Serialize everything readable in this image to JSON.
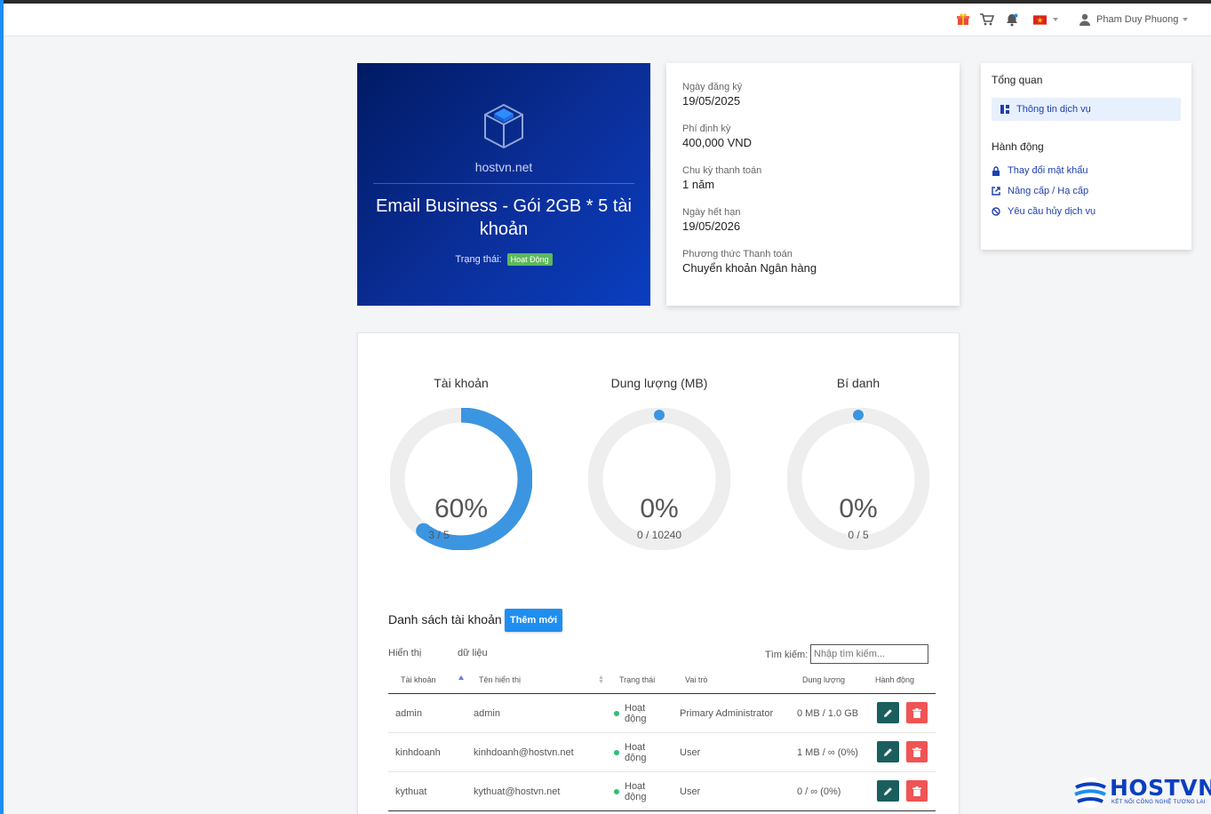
{
  "topbar": {
    "user_name": "Pham Duy Phuong",
    "icons": [
      "gift-icon",
      "cart-icon",
      "bell-icon",
      "vietnam-flag-icon",
      "user-icon"
    ]
  },
  "hero": {
    "brand": "hostvn.net",
    "title": "Email Business - Gói 2GB * 5 tài khoản",
    "status_label": "Trạng thái:",
    "status_value": "Hoạt Động"
  },
  "info": {
    "items": [
      {
        "label": "Ngày đăng ký",
        "value": "19/05/2025"
      },
      {
        "label": "Phí định kỳ",
        "value": "400,000 VND"
      },
      {
        "label": "Chu kỳ thanh toán",
        "value": "1 năm"
      },
      {
        "label": "Ngày hết hạn",
        "value": "19/05/2026"
      },
      {
        "label": "Phương thức Thanh toán",
        "value": "Chuyển khoản Ngân hàng"
      }
    ]
  },
  "sidebar": {
    "overview_title": "Tổng quan",
    "overview_item": "Thông tin dịch vụ",
    "actions_title": "Hành động",
    "actions": [
      {
        "label": "Thay đổi mật khẩu",
        "icon": "lock-icon"
      },
      {
        "label": "Nâng cấp / Hạ cấp",
        "icon": "external-link-icon"
      },
      {
        "label": "Yêu cầu hủy dịch vụ",
        "icon": "ban-icon"
      }
    ]
  },
  "gauges": [
    {
      "title": "Tài khoản",
      "percent_text": "60%",
      "detail": "3 / 5",
      "fraction": 0.6
    },
    {
      "title": "Dung lượng (MB)",
      "percent_text": "0%",
      "detail": "0 / 10240",
      "fraction": 0
    },
    {
      "title": "Bí danh",
      "percent_text": "0%",
      "detail": "0 / 5",
      "fraction": 0
    }
  ],
  "colors": {
    "gauge_fill": "#3b95e0",
    "gauge_track": "#eeeeee",
    "accent": "#1f8ef1"
  },
  "accounts": {
    "title": "Danh sách tài khoản",
    "add_label": "Thêm mới",
    "show_label": "Hiển thị",
    "data_label": "dữ liệu",
    "search_label": "Tìm kiếm:",
    "search_placeholder": "Nhập tìm kiếm...",
    "columns": [
      "Tài khoản",
      "Tên hiển thị",
      "Trạng thái",
      "Vai trò",
      "Dung lượng",
      "Hành động"
    ],
    "rows": [
      {
        "account": "admin",
        "display": "admin",
        "status_1": "Hoạt",
        "status_2": "động",
        "role": "Primary Administrator",
        "usage": "0 MB / 1.0 GB"
      },
      {
        "account": "kinhdoanh",
        "display": "kinhdoanh@hostvn.net",
        "status_1": "Hoạt",
        "status_2": "động",
        "role": "User",
        "usage": "1 MB / ∞ (0%)"
      },
      {
        "account": "kythuat",
        "display": "kythuat@hostvn.net",
        "status_1": "Hoạt",
        "status_2": "động",
        "role": "User",
        "usage": "0 / ∞ (0%)"
      }
    ]
  },
  "logo": {
    "word": "HOSTVN",
    "tagline": "KẾT NỐI CÔNG NGHỆ TƯƠNG LAI"
  }
}
